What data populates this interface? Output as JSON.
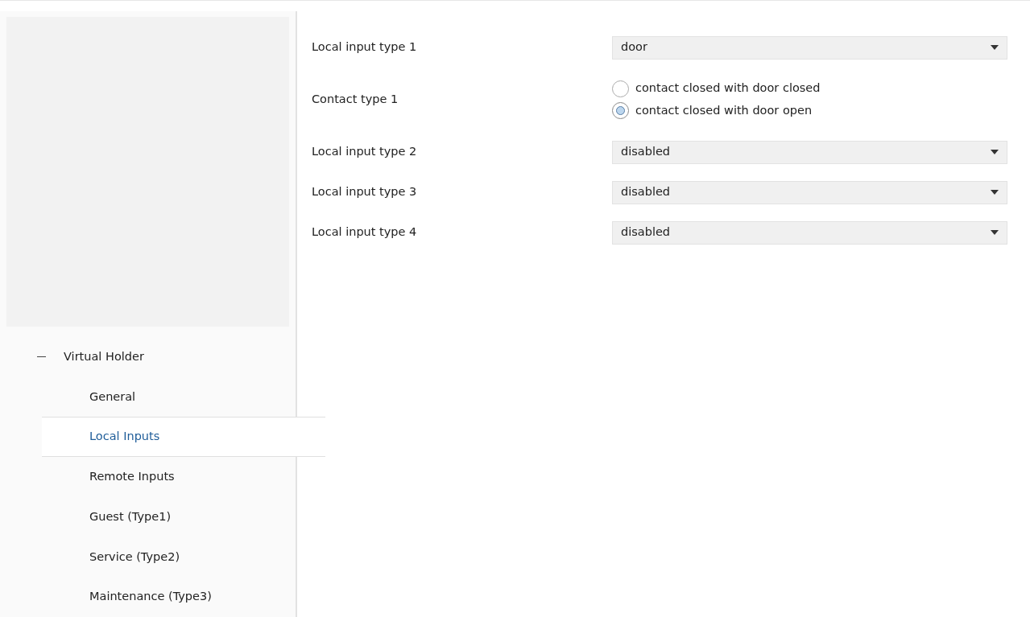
{
  "tree": [
    {
      "label": "Virtual Holder",
      "expanded": true,
      "children": [
        {
          "label": "General",
          "selected": false
        },
        {
          "label": "Local Inputs",
          "selected": true
        },
        {
          "label": "Remote Inputs",
          "selected": false
        },
        {
          "label": "Guest (Type1)",
          "selected": false
        },
        {
          "label": "Service (Type2)",
          "selected": false
        },
        {
          "label": "Maintenance (Type3)",
          "selected": false
        }
      ]
    }
  ],
  "parameters": [
    {
      "kind": "select",
      "label": "Local input type 1",
      "value": "door"
    },
    {
      "kind": "radio",
      "label": "Contact type 1",
      "options": [
        {
          "label": "contact closed with door closed",
          "selected": false
        },
        {
          "label": "contact closed with door open",
          "selected": true
        }
      ]
    },
    {
      "kind": "select",
      "label": "Local input type 2",
      "value": "disabled"
    },
    {
      "kind": "select",
      "label": "Local input type 3",
      "value": "disabled"
    },
    {
      "kind": "select",
      "label": "Local input type 4",
      "value": "disabled"
    }
  ]
}
